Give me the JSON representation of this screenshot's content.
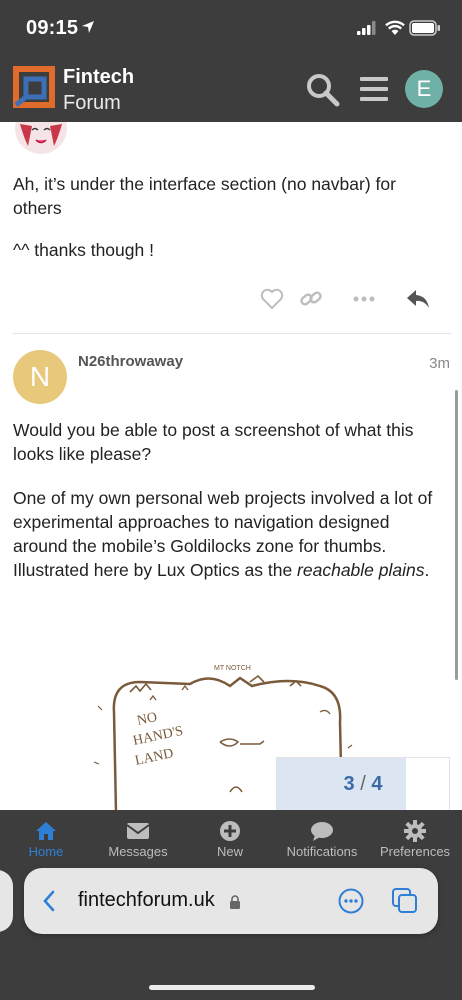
{
  "status": {
    "time": "09:15"
  },
  "header": {
    "brand_line1": "Fintech",
    "brand_line2": "Forum",
    "user_initial": "E"
  },
  "post1": {
    "paragraph1": "Ah, it’s under the interface section (no navbar) for others",
    "paragraph2": "^^ thanks though !"
  },
  "post2": {
    "avatar_letter": "N",
    "username": "N26throwaway",
    "time": "3m",
    "paragraph1": "Would you be able to post a screenshot of what this looks like please?",
    "paragraph2_prefix": "One of my own personal web projects involved a lot of experimental approaches to navigation designed around the mobile’s Goldilocks zone for thumbs. Illustrated here by Lux Optics as the ",
    "paragraph2_emphasis": "reachable plains",
    "paragraph2_suffix": ".",
    "image_labels": {
      "top": "MT NOTCH",
      "left_line1": "NO",
      "left_line2": "HAND'S",
      "left_line3": "LAND"
    }
  },
  "progress": {
    "current": "3",
    "separator": "/",
    "total": "4",
    "fraction": 0.75
  },
  "tabbar": {
    "tabs": [
      {
        "label": "Home",
        "icon": "home-icon",
        "active": true
      },
      {
        "label": "Messages",
        "icon": "envelope-icon",
        "active": false
      },
      {
        "label": "New",
        "icon": "plus-circle-icon",
        "active": false
      },
      {
        "label": "Notifications",
        "icon": "speech-bubble-icon",
        "active": false
      },
      {
        "label": "Preferences",
        "icon": "gear-icon",
        "active": false
      }
    ]
  },
  "browser": {
    "domain": "fintechforum.uk"
  },
  "colors": {
    "header_bg": "#3d3d3d",
    "accent": "#2f7fd6",
    "avatar_e": "#6fb1a6",
    "avatar_n": "#e8c97b"
  }
}
